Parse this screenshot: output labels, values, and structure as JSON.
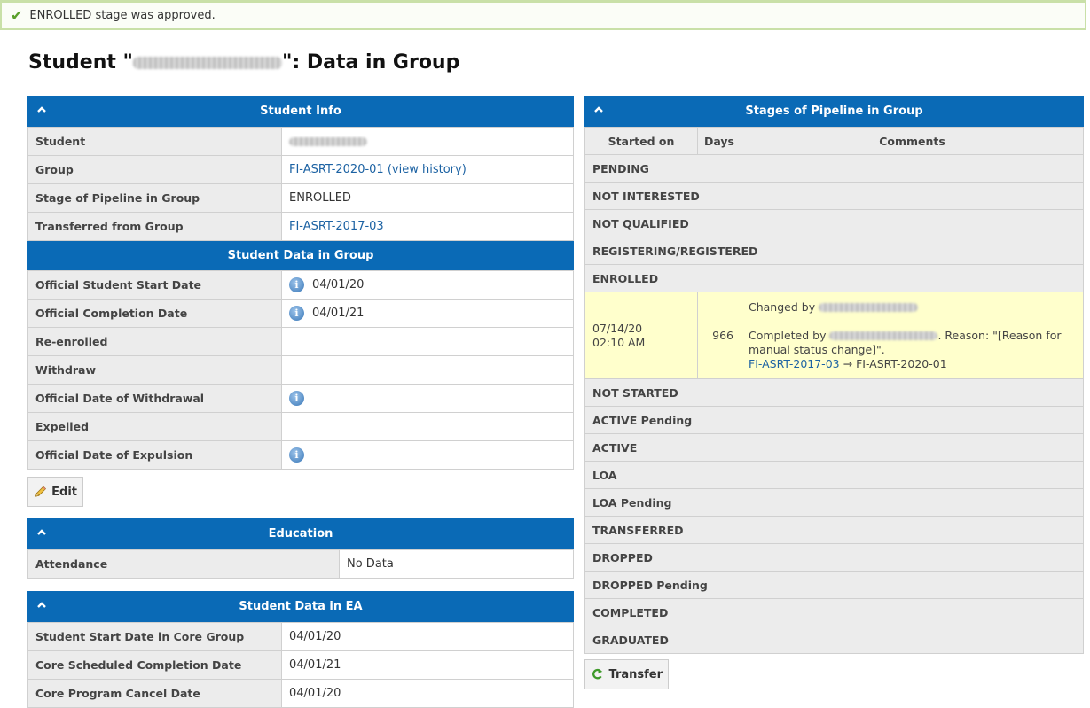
{
  "alert": {
    "text": "ENROLLED stage was approved."
  },
  "page": {
    "title_prefix": "Student \"",
    "title_suffix": "\": Data in Group"
  },
  "student_info": {
    "header": "Student Info",
    "rows": [
      {
        "label": "Student",
        "value": ""
      },
      {
        "label": "Group",
        "value": "FI-ASRT-2020-01",
        "extra": "(view history)"
      },
      {
        "label": "Stage of Pipeline in Group",
        "value": "ENROLLED"
      },
      {
        "label": "Transferred from Group",
        "value": "FI-ASRT-2017-03"
      }
    ],
    "subheader": "Student Data in Group",
    "data_rows": [
      {
        "label": "Official Student Start Date",
        "value": "04/01/20",
        "info": true
      },
      {
        "label": "Official Completion Date",
        "value": "04/01/21",
        "info": true
      },
      {
        "label": "Re-enrolled",
        "value": ""
      },
      {
        "label": "Withdraw",
        "value": ""
      },
      {
        "label": "Official Date of Withdrawal",
        "value": "",
        "info": true
      },
      {
        "label": "Expelled",
        "value": ""
      },
      {
        "label": "Official Date of Expulsion",
        "value": "",
        "info": true
      }
    ],
    "edit_label": "Edit"
  },
  "education": {
    "header": "Education",
    "rows": [
      {
        "label": "Attendance",
        "value": "No Data"
      }
    ]
  },
  "ea": {
    "header": "Student Data in EA",
    "rows": [
      {
        "label": "Student Start Date in Core Group",
        "value": "04/01/20"
      },
      {
        "label": "Core Scheduled Completion Date",
        "value": "04/01/21"
      },
      {
        "label": "Core Program Cancel Date",
        "value": "04/01/20"
      }
    ]
  },
  "stages": {
    "header": "Stages of Pipeline in Group",
    "columns": [
      "Started on",
      "Days",
      "Comments"
    ],
    "before": [
      "PENDING",
      "NOT INTERESTED",
      "NOT QUALIFIED",
      "REGISTERING/REGISTERED",
      "ENROLLED"
    ],
    "entry": {
      "started_date": "07/14/20",
      "started_time": "02:10 AM",
      "days": "966",
      "changed_by": "Changed by",
      "completed_by": "Completed by",
      "reason": ". Reason: \"[Reason for manual status change]\".",
      "from_group": "FI-ASRT-2017-03",
      "arrow": "→",
      "to_group": "FI-ASRT-2020-01"
    },
    "after": [
      "NOT STARTED",
      "ACTIVE Pending",
      "ACTIVE",
      "LOA",
      "LOA Pending",
      "TRANSFERRED",
      "DROPPED",
      "DROPPED Pending",
      "COMPLETED",
      "GRADUATED"
    ],
    "transfer_label": "Transfer"
  }
}
